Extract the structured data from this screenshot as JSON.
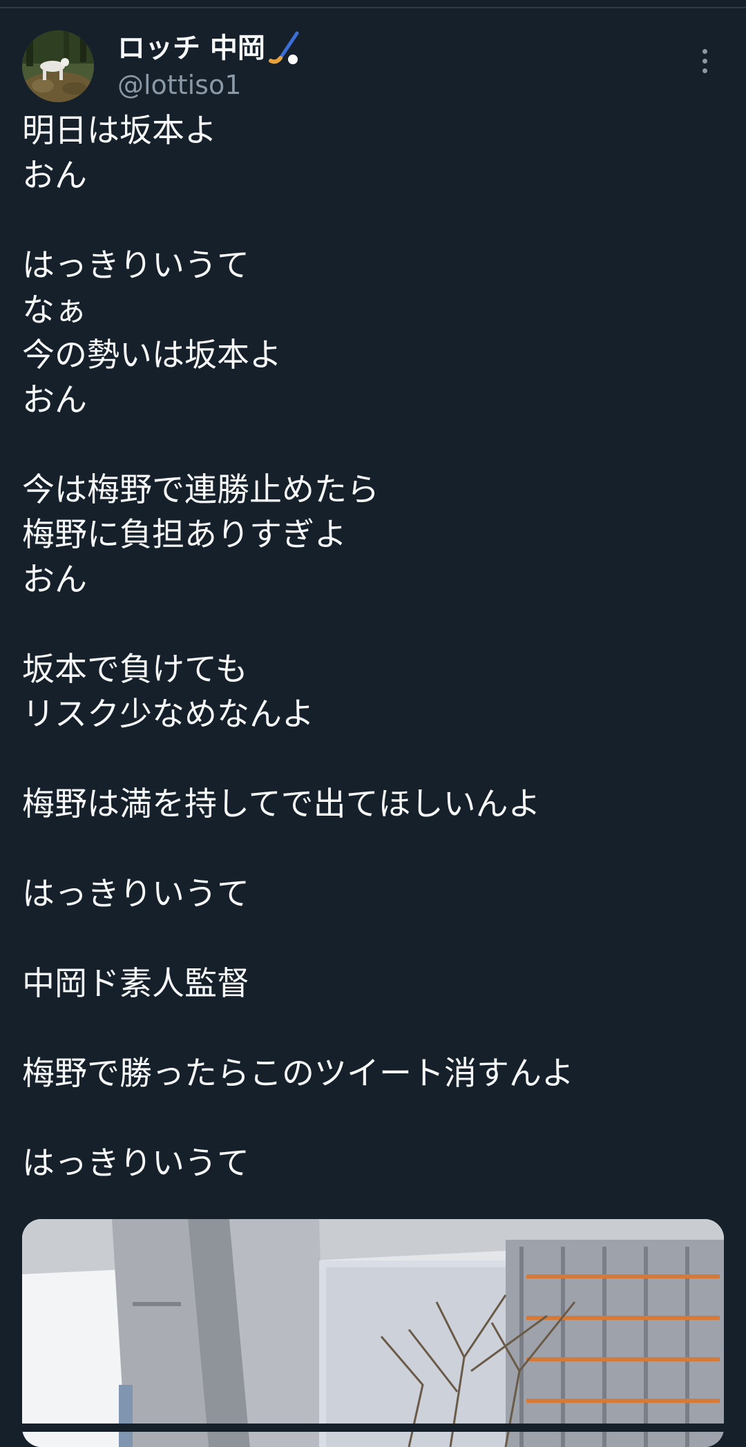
{
  "tweet": {
    "author": {
      "display_name": "ロッチ 中岡",
      "handle": "@lottiso1",
      "name_emoji_icon": "hockey-stick-icon"
    },
    "more_icon": "more-vertical-icon",
    "lines": [
      "明日は坂本よ",
      "おん",
      "",
      "はっきりいうて",
      "なぁ",
      "今の勢いは坂本よ",
      "おん",
      "",
      "今は梅野で連勝止めたら",
      "梅野に負担ありすぎよ",
      "おん",
      "",
      "坂本で負けても",
      "リスク少なめなんよ",
      "",
      "梅野は満を持してで出てほしいんよ",
      "",
      "はっきりいうて",
      "",
      "中岡ド素人監督",
      "",
      "梅野で勝ったらこのツイート消すんよ",
      "",
      "はっきりいうて"
    ]
  },
  "colors": {
    "background": "#15202b",
    "text": "#f7f9f9",
    "secondary_text": "#8b98a5"
  }
}
